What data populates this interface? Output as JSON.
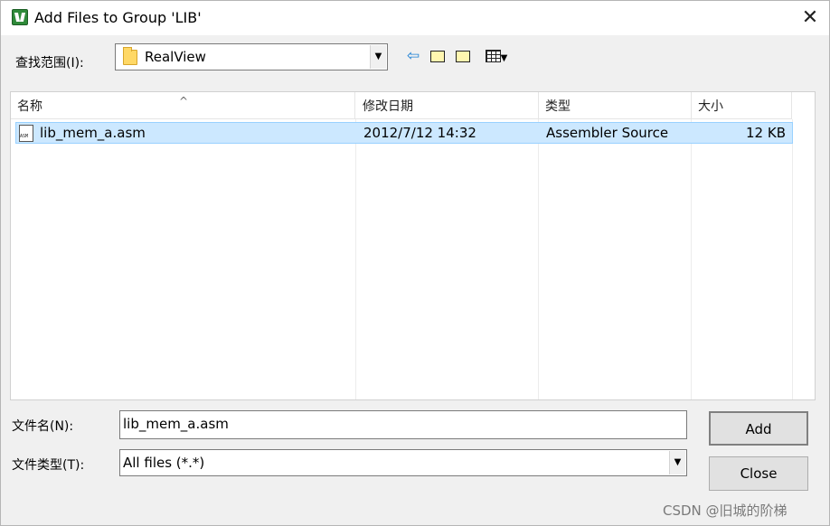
{
  "window": {
    "title": "Add Files to Group 'LIB'",
    "close_glyph": "✕"
  },
  "lookin": {
    "label": "查找范围(I):",
    "value": "RealView",
    "folder_icon": "folder-icon"
  },
  "toolbar": {
    "icons": [
      "back-icon",
      "up-folder-icon",
      "new-folder-icon",
      "view-menu-icon"
    ]
  },
  "list": {
    "columns": [
      "名称",
      "修改日期",
      "类型",
      "大小"
    ],
    "rows": [
      {
        "name": "lib_mem_a.asm",
        "modified": "2012/7/12 14:32",
        "type": "Assembler Source",
        "size": "12 KB",
        "selected": true
      }
    ]
  },
  "filename": {
    "label": "文件名(N):",
    "value": "lib_mem_a.asm"
  },
  "filetype": {
    "label": "文件类型(T):",
    "value": "All files (*.*)"
  },
  "buttons": {
    "add": "Add",
    "close": "Close"
  },
  "watermark": "CSDN @旧城的阶梯",
  "colors": {
    "selection_bg": "#cce8ff",
    "selection_border": "#99d1ff",
    "dialog_bg": "#f0f0f0"
  }
}
